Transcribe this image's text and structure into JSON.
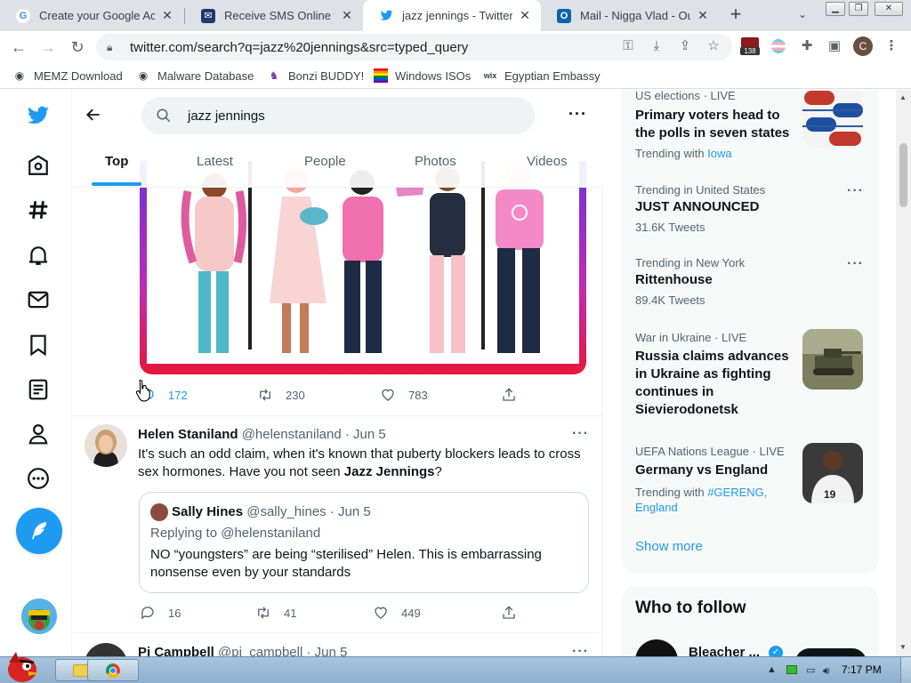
{
  "browser": {
    "tabs": [
      {
        "title": "Create your Google Ac",
        "favicon": "google-icon"
      },
      {
        "title": "Receive SMS Online for",
        "favicon": "sms-site-icon"
      },
      {
        "title": "jazz jennings - Twitter S",
        "favicon": "twitter-icon",
        "active": true
      },
      {
        "title": "Mail - Nigga Vlad - Out",
        "favicon": "outlook-icon"
      }
    ],
    "new_tab": "+",
    "url": "twitter.com/search?q=jazz%20jennings&src=typed_query",
    "extension_badge": "138",
    "profile_initial": "C",
    "bookmarks": [
      {
        "label": "MEMZ Download",
        "icon": "globe-icon"
      },
      {
        "label": "Malware Database",
        "icon": "globe-icon"
      },
      {
        "label": "Bonzi BUDDY!",
        "icon": "bonzi-icon"
      },
      {
        "label": "Windows ISOs",
        "icon": "windows-icon"
      },
      {
        "label": "Egyptian Embassy",
        "icon": "wix-icon"
      }
    ]
  },
  "search": {
    "query": "jazz jennings",
    "tabs": [
      "Top",
      "Latest",
      "People",
      "Photos",
      "Videos"
    ],
    "active_tab": "Top"
  },
  "tweets": [
    {
      "id": "media-tweet",
      "replies": "172",
      "retweets": "230",
      "likes": "783"
    },
    {
      "id": "helen",
      "name": "Helen Staniland",
      "handle": "@helenstaniland",
      "date": "· Jun 5",
      "text_before": "It's such an odd claim, when it's known that puberty blockers leads to cross sex hormones. Have you not seen ",
      "text_bold": "Jazz Jennings",
      "text_after": "?",
      "quote": {
        "name": "Sally Hines",
        "handle": "@sally_hines",
        "date": "· Jun 5",
        "replying": "Replying to @helenstaniland",
        "text": "NO “youngsters” are being “sterilised” Helen. This is embarrassing nonsense even by your standards"
      },
      "replies": "16",
      "retweets": "41",
      "likes": "449"
    },
    {
      "id": "pj",
      "name": "Pj Campbell",
      "handle": "@pj_campbell",
      "date": "· Jun 5"
    }
  ],
  "trends": [
    {
      "meta": "US elections · LIVE",
      "title": "Primary voters head to the polls in seven states",
      "sub_prefix": "Trending with",
      "sub_links": [
        "Iowa"
      ],
      "image": "vote-stickers-image"
    },
    {
      "meta": "Trending in United States",
      "title": "JUST ANNOUNCED",
      "sub": "31.6K Tweets"
    },
    {
      "meta": "Trending in New York",
      "title": "Rittenhouse",
      "sub": "89.4K Tweets"
    },
    {
      "meta": "War in Ukraine · LIVE",
      "title": "Russia claims advances in Ukraine as fighting continues in Sievierodonetsk",
      "image": "tank-image"
    },
    {
      "meta": "UEFA Nations League · LIVE",
      "title": "Germany vs England",
      "sub_prefix": "Trending with",
      "sub_links": [
        "#GERENG,",
        "England"
      ],
      "image": "footballer-image"
    }
  ],
  "show_more": "Show more",
  "who_to_follow": {
    "heading": "Who to follow",
    "first_name": "Bleacher ..."
  },
  "taskbar": {
    "time": "7:17 PM"
  },
  "colors": {
    "twitter_blue": "#1d9bf0",
    "text_secondary": "#536471"
  }
}
